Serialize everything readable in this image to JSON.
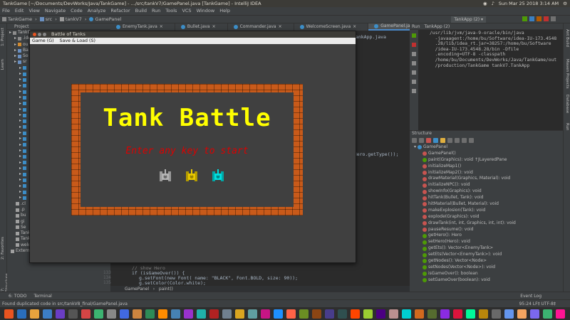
{
  "os": {
    "window_title": "TankGame [~/Documents/DevWorks/Java/TankGame] - .../src/tankV7/GamePanel.java [TankGame] - IntelliJ IDEA",
    "datetime": "Sun Mar 25 2018  3:14 AM"
  },
  "menu": [
    "File",
    "Edit",
    "View",
    "Navigate",
    "Code",
    "Analyze",
    "Refactor",
    "Build",
    "Run",
    "Tools",
    "VCS",
    "Window",
    "Help"
  ],
  "nav": {
    "crumbs": [
      "TankGame",
      "src",
      "tankV7",
      "GamePanel"
    ],
    "run_config": "TankApp (2)"
  },
  "left_strip": [
    "1: Project",
    "Learn",
    "2: Favorites",
    "7: Structure"
  ],
  "right_strip": [
    "Ant Build",
    "Maven Projects",
    "Database",
    "Run"
  ],
  "project": {
    "header": "Project",
    "rows": [
      {
        "label": "TankG",
        "indent": 0
      },
      {
        "label": ".ide",
        "indent": 1
      },
      {
        "label": "ou",
        "indent": 1
      },
      {
        "label": "Ba",
        "indent": 1
      },
      {
        "label": "So",
        "indent": 1
      },
      {
        "label": "sr",
        "indent": 1
      },
      {
        "label": "",
        "indent": 2
      },
      {
        "label": "",
        "indent": 2
      },
      {
        "label": "",
        "indent": 2
      },
      {
        "label": "",
        "indent": 2
      },
      {
        "label": "",
        "indent": 2
      },
      {
        "label": "",
        "indent": 2
      },
      {
        "label": "",
        "indent": 2
      },
      {
        "label": "",
        "indent": 2
      },
      {
        "label": "",
        "indent": 2
      },
      {
        "label": "",
        "indent": 2
      },
      {
        "label": "",
        "indent": 2
      },
      {
        "label": "",
        "indent": 2
      },
      {
        "label": "",
        "indent": 2
      },
      {
        "label": "",
        "indent": 2
      },
      {
        "label": "",
        "indent": 2
      },
      {
        "label": "",
        "indent": 2
      },
      {
        "label": "",
        "indent": 2
      },
      {
        "label": "",
        "indent": 2
      },
      {
        "label": "",
        "indent": 2
      },
      {
        "label": "",
        "indent": 2
      },
      {
        "label": "",
        "indent": 2
      },
      {
        "label": "",
        "indent": 2
      },
      {
        "label": "",
        "indent": 2
      },
      {
        "label": ".cl",
        "indent": 1
      },
      {
        "label": ".p",
        "indent": 1
      },
      {
        "label": "bu",
        "indent": 1
      },
      {
        "label": "gi",
        "indent": 1
      },
      {
        "label": "Se",
        "indent": 1
      },
      {
        "label": "TankGame.iml",
        "indent": 1
      },
      {
        "label": "TankGame.userlibraries",
        "indent": 1
      },
      {
        "label": "welcomescreen.png",
        "indent": 1
      },
      {
        "label": "External Libraries",
        "indent": 0
      }
    ]
  },
  "editor_tabs": [
    {
      "label": "EnemyTank.java",
      "active": false
    },
    {
      "label": "Bullet.java",
      "active": false
    },
    {
      "label": "Commander.java",
      "active": false
    },
    {
      "label": "WelcomeScreen.java",
      "active": false
    },
    {
      "label": "GamePanel.java",
      "active": true
    }
  ],
  "editor": {
    "second_tab": "TankApp.java",
    "peek_code": "), Hero.getType());",
    "line_numbers": [
      "133",
      "134",
      "135"
    ],
    "code_lines": [
      "  // show Hero",
      "  if (isGameOver()) {",
      "      g.setFont(new Font( name: \"BLACK\", Font.BOLD,  size: 90));",
      "      g.setColor(Color.white);"
    ],
    "breadcrumb": [
      "GamePanel",
      "paint()"
    ]
  },
  "run": {
    "tab": "Run",
    "config": "TankApp (2)",
    "output": "/usr/lib/jvm/java-9-oracle/bin/java\n  -javaagent:/home/bu/Software/idea-IU-173.4548\n  .28/lib/idea_rt.jar=38257:/home/bu/Software\n  /idea-IU-173.4548.28/bin -Dfile\n  .encoding=UTF-8 -classpath\n  /home/bu/Documents/DevWorks/Java/TankGame/out\n  /production/TankGame tankV7.TankApp"
  },
  "structure": {
    "header": "Structure",
    "root": "GamePanel",
    "items": [
      {
        "label": "GamePanel()",
        "kind": "m"
      },
      {
        "label": "paint(Graphics): void ↑JLayeredPane",
        "kind": "m"
      },
      {
        "label": "initializeMap1()",
        "kind": "m"
      },
      {
        "label": "initializeMap2(): void",
        "kind": "m"
      },
      {
        "label": "drawMaterial(Graphics, Material): void",
        "kind": "m"
      },
      {
        "label": "initializeNPC(): void",
        "kind": "m"
      },
      {
        "label": "showInfo(Graphics): void",
        "kind": "m"
      },
      {
        "label": "hitTank(Bullet, Tank): void",
        "kind": "m"
      },
      {
        "label": "hitMaterial(Bullet, Material): void",
        "kind": "m"
      },
      {
        "label": "makeExplosion(Tank): void",
        "kind": "m"
      },
      {
        "label": "explode(Graphics): void",
        "kind": "m"
      },
      {
        "label": "drawTank(int, int, Graphics, int, int): void",
        "kind": "m"
      },
      {
        "label": "pauseResume(): void",
        "kind": "m"
      },
      {
        "label": "getHero(): Hero",
        "kind": "m"
      },
      {
        "label": "setHero(Hero): void",
        "kind": "m"
      },
      {
        "label": "getEts(): Vector<EnemyTank>",
        "kind": "m"
      },
      {
        "label": "setEts(Vector<EnemyTank>): void",
        "kind": "m"
      },
      {
        "label": "getNodes(): Vector<Node>",
        "kind": "m"
      },
      {
        "label": "setNodes(Vector<Node>): void",
        "kind": "m"
      },
      {
        "label": "isGameOver(): boolean",
        "kind": "m"
      },
      {
        "label": "setGameOver(boolean): void",
        "kind": "m"
      }
    ]
  },
  "bottom_tabs": [
    "6: TODO",
    "Terminal",
    "Event Log"
  ],
  "status": {
    "message": "Found duplicated code in src/tankV8_final/GamePanel.java",
    "right": "95:24   LF‡   UTF-8‡"
  },
  "game": {
    "window_title": "Battle of Tanks",
    "menu": [
      "Game (G)",
      "Save & Load (S)"
    ],
    "title": "Tank Battle",
    "prompt": "Enter any key to start",
    "tank_colors": [
      "#b4b4b4",
      "#e8c800",
      "#00e0e0"
    ]
  }
}
